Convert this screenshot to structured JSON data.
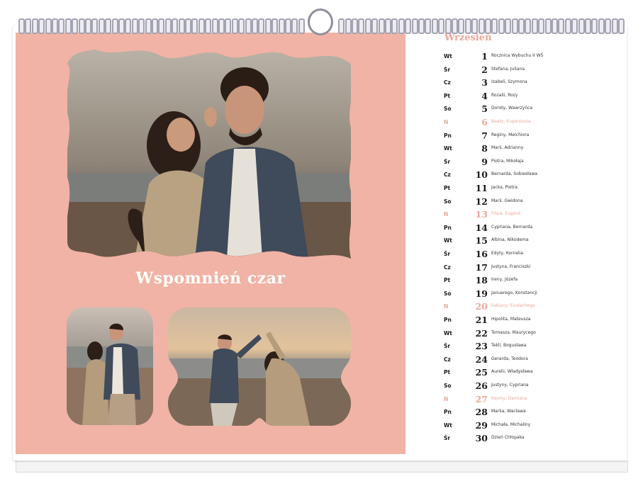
{
  "calendar": {
    "cover_title": "Wspomnień czar",
    "month": "Wrzesień",
    "colors": {
      "panel": "#f0b3a5",
      "sunday": "#eaa898",
      "text": "#1a1a1a"
    },
    "days": [
      {
        "dow": "Wt",
        "num": "1",
        "names": "Rocznica Wybuchu II WŚ",
        "sunday": false
      },
      {
        "dow": "Śr",
        "num": "2",
        "names": "Stefana, Juliana",
        "sunday": false
      },
      {
        "dow": "Cz",
        "num": "3",
        "names": "Izabeli, Szymona",
        "sunday": false
      },
      {
        "dow": "Pt",
        "num": "4",
        "names": "Rozalii, Rozy",
        "sunday": false
      },
      {
        "dow": "So",
        "num": "5",
        "names": "Doroty, Wawrzyńca",
        "sunday": false
      },
      {
        "dow": "N",
        "num": "6",
        "names": "Beaty, Eugeniusza",
        "sunday": true
      },
      {
        "dow": "Pn",
        "num": "7",
        "names": "Reginy, Melchiora",
        "sunday": false
      },
      {
        "dow": "Wt",
        "num": "8",
        "names": "Marii, Adrianny",
        "sunday": false
      },
      {
        "dow": "Śr",
        "num": "9",
        "names": "Piotra, Mikołaja",
        "sunday": false
      },
      {
        "dow": "Cz",
        "num": "10",
        "names": "Bernarda, Sobiesława",
        "sunday": false
      },
      {
        "dow": "Pt",
        "num": "11",
        "names": "Jacka, Piotra",
        "sunday": false
      },
      {
        "dow": "So",
        "num": "12",
        "names": "Marii, Gwidona",
        "sunday": false
      },
      {
        "dow": "N",
        "num": "13",
        "names": "Filipa, Eugenii",
        "sunday": true
      },
      {
        "dow": "Pn",
        "num": "14",
        "names": "Cypriana, Bernarda",
        "sunday": false
      },
      {
        "dow": "Wt",
        "num": "15",
        "names": "Albina, Nikodema",
        "sunday": false
      },
      {
        "dow": "Śr",
        "num": "16",
        "names": "Edyty, Korneliа",
        "sunday": false
      },
      {
        "dow": "Cz",
        "num": "17",
        "names": "Justyna, Franciszki",
        "sunday": false
      },
      {
        "dow": "Pt",
        "num": "18",
        "names": "Ireny, Józefa",
        "sunday": false
      },
      {
        "dow": "So",
        "num": "19",
        "names": "Januarego, Konstancji",
        "sunday": false
      },
      {
        "dow": "N",
        "num": "20",
        "names": "Fabiany, Eustachego",
        "sunday": true
      },
      {
        "dow": "Pn",
        "num": "21",
        "names": "Hipolita, Mateusza",
        "sunday": false
      },
      {
        "dow": "Wt",
        "num": "22",
        "names": "Tomasza, Maurycego",
        "sunday": false
      },
      {
        "dow": "Śr",
        "num": "23",
        "names": "Tekli, Bogusława",
        "sunday": false
      },
      {
        "dow": "Cz",
        "num": "24",
        "names": "Gerarda, Teodora",
        "sunday": false
      },
      {
        "dow": "Pt",
        "num": "25",
        "names": "Aurelii, Władysława",
        "sunday": false
      },
      {
        "dow": "So",
        "num": "26",
        "names": "Justyny, Cypriana",
        "sunday": false
      },
      {
        "dow": "N",
        "num": "27",
        "names": "Kosmy, Damiana",
        "sunday": true
      },
      {
        "dow": "Pn",
        "num": "28",
        "names": "Marka, Wacława",
        "sunday": false
      },
      {
        "dow": "Wt",
        "num": "29",
        "names": "Michała, Michaliny",
        "sunday": false
      },
      {
        "dow": "Śr",
        "num": "30",
        "names": "Dzień Chłopaka",
        "sunday": false
      }
    ]
  }
}
